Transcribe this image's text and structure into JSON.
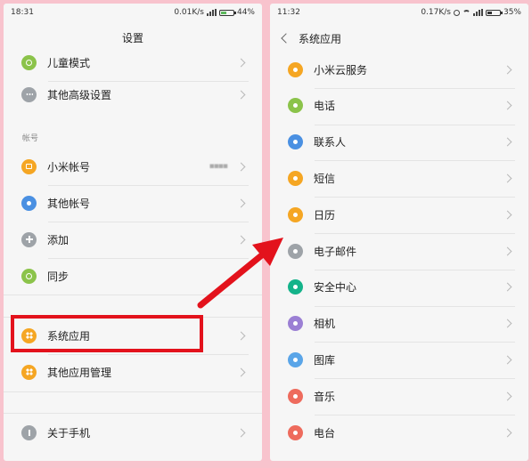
{
  "colors": {
    "background": "#f8c3cd",
    "highlight": "#e3121c",
    "arrow": "#e3121c",
    "icon_green": "#8bc34a",
    "icon_gray": "#9ea3a8",
    "icon_orange": "#f5a623",
    "icon_blue": "#4a90e2",
    "icon_red": "#ee6b5d",
    "icon_teal": "#14b38a",
    "icon_purple": "#9b7fd4",
    "icon_lightblue": "#5aa5e8"
  },
  "left": {
    "status": {
      "time": "18:31",
      "speed": "0.01K/s",
      "battery": "44%",
      "battery_level": 0.44
    },
    "title": "设置",
    "items_top": [
      {
        "label": "儿童模式",
        "icon": "child-mode-icon",
        "color": "#8bc34a"
      },
      {
        "label": "其他高级设置",
        "icon": "more-dots-icon",
        "color": "#9ea3a8"
      }
    ],
    "section_accounts": "帐号",
    "accounts": [
      {
        "label": "小米帐号",
        "icon": "mi-account-icon",
        "color": "#f5a623",
        "value": "▪▪▪▪"
      },
      {
        "label": "其他帐号",
        "icon": "person-icon",
        "color": "#4a90e2"
      },
      {
        "label": "添加",
        "icon": "add-icon",
        "color": "#9ea3a8"
      },
      {
        "label": "同步",
        "icon": "sync-icon",
        "color": "#8bc34a"
      }
    ],
    "apps": [
      {
        "label": "系统应用",
        "icon": "system-apps-icon",
        "color": "#f5a623"
      },
      {
        "label": "其他应用管理",
        "icon": "other-apps-icon",
        "color": "#f5a623"
      }
    ],
    "about": {
      "label": "关于手机",
      "icon": "info-icon",
      "color": "#9ea3a8"
    }
  },
  "right": {
    "status": {
      "time": "11:32",
      "speed": "0.17K/s",
      "battery": "35%",
      "battery_level": 0.35
    },
    "title": "系统应用",
    "items": [
      {
        "label": "小米云服务",
        "icon": "cloud-icon",
        "color": "#f5a623"
      },
      {
        "label": "电话",
        "icon": "phone-icon",
        "color": "#8bc34a"
      },
      {
        "label": "联系人",
        "icon": "contacts-icon",
        "color": "#4a90e2"
      },
      {
        "label": "短信",
        "icon": "message-icon",
        "color": "#f5a623"
      },
      {
        "label": "日历",
        "icon": "calendar-icon",
        "color": "#f5a623"
      },
      {
        "label": "电子邮件",
        "icon": "email-icon",
        "color": "#9ea3a8"
      },
      {
        "label": "安全中心",
        "icon": "security-icon",
        "color": "#14b38a"
      },
      {
        "label": "相机",
        "icon": "camera-icon",
        "color": "#9b7fd4"
      },
      {
        "label": "图库",
        "icon": "gallery-icon",
        "color": "#5aa5e8"
      },
      {
        "label": "音乐",
        "icon": "music-icon",
        "color": "#ee6b5d"
      },
      {
        "label": "电台",
        "icon": "radio-icon",
        "color": "#ee6b5d"
      }
    ]
  }
}
